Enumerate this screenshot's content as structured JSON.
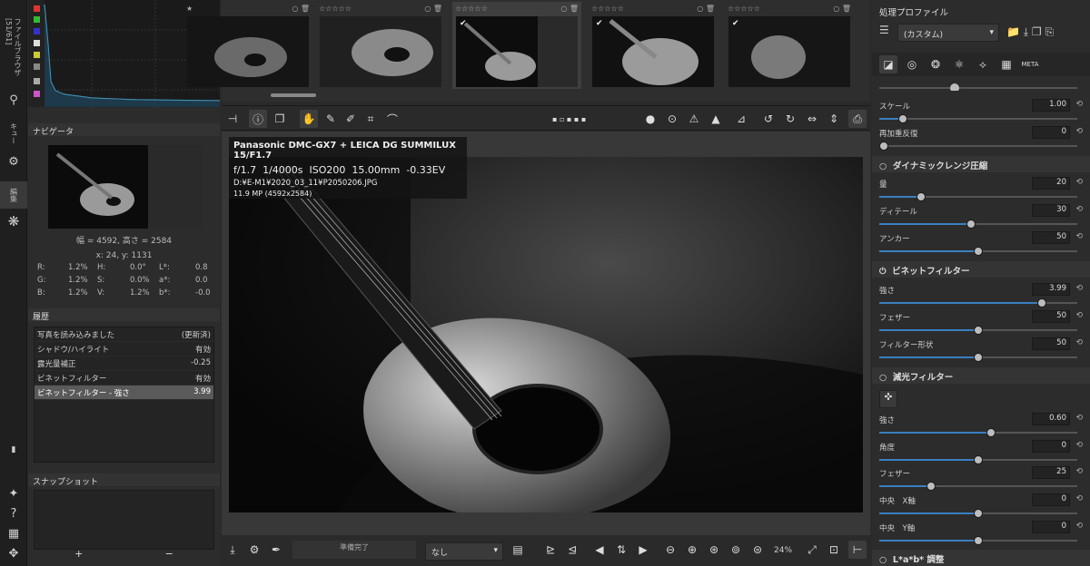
{
  "left_tabs": {
    "file_browser": "ファイルブラウザ [51/61]",
    "queue": "キュー",
    "editor": "編集"
  },
  "navigator": {
    "title": "ナビゲータ",
    "size": "幅 = 4592, 高さ = 2584",
    "coord": "x: 24, y: 1131",
    "r_label": "R:",
    "r_val": "1.2%",
    "g_label": "G:",
    "g_val": "1.2%",
    "b_label": "B:",
    "b_val": "1.2%",
    "h_label": "H:",
    "h_val": "0.0°",
    "s_label": "S:",
    "s_val": "0.0%",
    "v_label": "V:",
    "v_val": "1.2%",
    "l_label": "L*:",
    "l_val": "0.8",
    "a_label": "a*:",
    "a_val": "0.0",
    "bb_label": "b*:",
    "bb_val": "-0.0"
  },
  "history": {
    "title": "履歴",
    "rows": [
      {
        "name": "写真を読み込みました",
        "value": "(更新済)"
      },
      {
        "name": "シャドウ/ハイライト",
        "value": "有効"
      },
      {
        "name": "露光量補正",
        "value": "-0.25"
      },
      {
        "name": "ビネットフィルター",
        "value": "有効"
      },
      {
        "name": "ビネットフィルター - 強さ",
        "value": "3.99"
      }
    ]
  },
  "snapshot": {
    "title": "スナップショット",
    "add": "+",
    "remove": "−"
  },
  "exif": {
    "camera": "Panasonic DMC-GX7 + LEICA DG SUMMILUX 15/F1.7",
    "aperture": "f/1.7",
    "shutter": "1/4000s",
    "iso": "ISO200",
    "focal": "15.00mm",
    "ev": "-0.33EV",
    "path": "D:¥E-M1¥2020_03_11¥P2050206.JPG",
    "mp": "11.9 MP (4592x2584)"
  },
  "bottombar": {
    "status": "準備完了",
    "select": "なし",
    "zoom": "24%"
  },
  "right": {
    "profile_title": "処理プロファイル",
    "profile_value": "(カスタム)",
    "scale_label": "スケール",
    "scale_val": "1.00",
    "rew_label": "再加重反復",
    "rew_val": "0",
    "dr_title": "ダイナミックレンジ圧縮",
    "amt_label": "量",
    "amt_val": "20",
    "det_label": "ディテール",
    "det_val": "30",
    "anc_label": "アンカー",
    "anc_val": "50",
    "vig_title": "ビネットフィルター",
    "str_label": "強さ",
    "str_val": "3.99",
    "fea_label": "フェザー",
    "fea_val": "50",
    "shape_label": "フィルター形状",
    "shape_val": "50",
    "grad_title": "減光フィルター",
    "gstr_label": "強さ",
    "gstr_val": "0.60",
    "ang_label": "角度",
    "ang_val": "0",
    "gfea_label": "フェザー",
    "gfea_val": "25",
    "cx_label": "中央　X軸",
    "cx_val": "0",
    "cy_label": "中央　Y軸",
    "cy_val": "0",
    "lab_title": "L*a*b* 調整"
  },
  "colors": {
    "accent": "#3a7fc1"
  }
}
